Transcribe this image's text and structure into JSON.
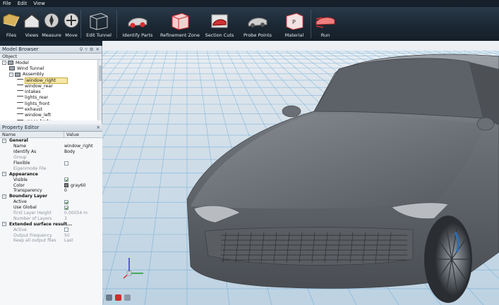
{
  "menu": [
    "File",
    "Edit",
    "View"
  ],
  "ribbon": [
    {
      "label": "Files",
      "icon": "folder-icon"
    },
    {
      "label": "Views",
      "icon": "house-icon"
    },
    {
      "label": "Measure",
      "icon": "compass-icon"
    },
    {
      "label": "Move",
      "icon": "move-icon"
    },
    {
      "label": "Edit Tunnel",
      "icon": "tunnel-icon"
    },
    {
      "label": "Identify Parts",
      "icon": "car-parts-icon"
    },
    {
      "label": "Refinement Zone",
      "icon": "refinement-box-icon"
    },
    {
      "label": "Section Cuts",
      "icon": "section-cut-icon"
    },
    {
      "label": "Probe Points",
      "icon": "probe-car-icon"
    },
    {
      "label": "Material",
      "icon": "material-box-icon"
    },
    {
      "label": "Run",
      "icon": "run-car-icon"
    }
  ],
  "model_browser": {
    "title": "Model Browser",
    "column": "Object",
    "tree": [
      {
        "label": "Model",
        "level": 0,
        "expander": "–"
      },
      {
        "label": "Wind Tunnel",
        "level": 1
      },
      {
        "label": "Assembly",
        "level": 1,
        "expander": "–"
      },
      {
        "label": "window_right",
        "level": 2,
        "selected": true
      },
      {
        "label": "window_rear",
        "level": 2
      },
      {
        "label": "intakes",
        "level": 2
      },
      {
        "label": "lights_rear",
        "level": 2
      },
      {
        "label": "lights_front",
        "level": 2
      },
      {
        "label": "exhaust",
        "level": 2
      },
      {
        "label": "window_left",
        "level": 2
      },
      {
        "label": "upper_body",
        "level": 2
      }
    ]
  },
  "property_editor": {
    "title": "Property Editor",
    "col_name": "Name",
    "col_value": "Value",
    "rows": [
      {
        "type": "group",
        "name": "General"
      },
      {
        "name": "Name",
        "value": "window_right"
      },
      {
        "name": "Identify As",
        "value": "Body"
      },
      {
        "name": "Group",
        "dim": true
      },
      {
        "name": "Flexible",
        "check": false
      },
      {
        "name": "Eigenmode File",
        "dim": true
      },
      {
        "type": "group",
        "name": "Appearance"
      },
      {
        "name": "Visible",
        "check": true
      },
      {
        "name": "Color",
        "value": "gray60",
        "swatch": "#777777"
      },
      {
        "name": "Transparency",
        "value": "0"
      },
      {
        "type": "group",
        "name": "Boundary Layer"
      },
      {
        "name": "Active",
        "check": true
      },
      {
        "name": "Use Global",
        "check": true
      },
      {
        "name": "First Layer Height",
        "value": "0.00054 m",
        "dim": true
      },
      {
        "name": "Number of Layers",
        "value": "3",
        "dim": true
      },
      {
        "type": "group",
        "name": "Extended surface result..."
      },
      {
        "name": "Active",
        "check": false,
        "dim": true
      },
      {
        "name": "Output Frequency",
        "value": "50",
        "dim": true
      },
      {
        "name": "Keep all output files",
        "value": "Last",
        "dim": true
      }
    ]
  },
  "colors": {
    "ribbon_bg": "#1a2631",
    "selection": "#f6e7a6",
    "car": "#6e7378",
    "grid": "#3a8fc8"
  }
}
